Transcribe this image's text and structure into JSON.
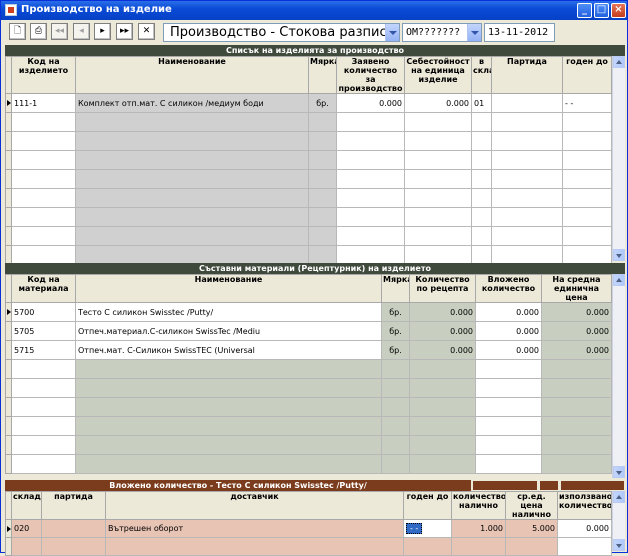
{
  "window": {
    "title": "Производство на изделие"
  },
  "toolbar": {
    "doc_combo": "Производство - Стокова разписка",
    "code_combo": "ОМ???????",
    "date": "13-11-2012"
  },
  "products": {
    "section_title": "Списък на изделията за производство",
    "headers": [
      "Код на изделието",
      "Наименование",
      "Мярка",
      "Заявено количество за производство",
      "Себестойност на единица изделие",
      "в склад",
      "Партида",
      "годен до"
    ],
    "rows": [
      {
        "code": "111-1",
        "name": "Комплект отп.мат. С силикон /медиум боди",
        "unit": "бр.",
        "qty": "0.000",
        "cost": "0.000",
        "store": "01",
        "batch": "",
        "expiry": "- -"
      }
    ]
  },
  "materials": {
    "section_title": "Съставни материали (Рецептурник) на изделието",
    "headers": [
      "Код на материала",
      "Наименование",
      "Мярка",
      "Количество по рецепта",
      "Вложено количество",
      "На средна единична цена"
    ],
    "rows": [
      {
        "code": "5700",
        "name": "Тесто С силикон Swisstec /Putty/",
        "unit": "бр.",
        "recipe": "0.000",
        "used": "0.000",
        "price": "0.000"
      },
      {
        "code": "5705",
        "name": "Отпеч.материал.С-силикон SwissTec /Mediu",
        "unit": "бр.",
        "recipe": "0.000",
        "used": "0.000",
        "price": "0.000"
      },
      {
        "code": "5715",
        "name": "Отпеч.мат. С-Силикон SwissTEC (Universal",
        "unit": "бр.",
        "recipe": "0.000",
        "used": "0.000",
        "price": "0.000"
      }
    ]
  },
  "inserted": {
    "section_title": "Вложено количество - Тесто С силикон Swisstec /Putty/",
    "headers": [
      "склад",
      "партида",
      "доставчик",
      "годен до",
      "количество налично",
      "ср.ед. цена налично",
      "използвано количество"
    ],
    "rows": [
      {
        "store": "020",
        "batch": "",
        "supplier": "Вътрешен оборот",
        "expiry": "- -",
        "available": "1.000",
        "price": "5.000",
        "used": "0.000"
      }
    ]
  },
  "colors": {
    "title_bar": "#0a4bd6",
    "dark_section": "#3f4a3c",
    "brown_section": "#7a3c1c",
    "selection": "#316ac5"
  }
}
